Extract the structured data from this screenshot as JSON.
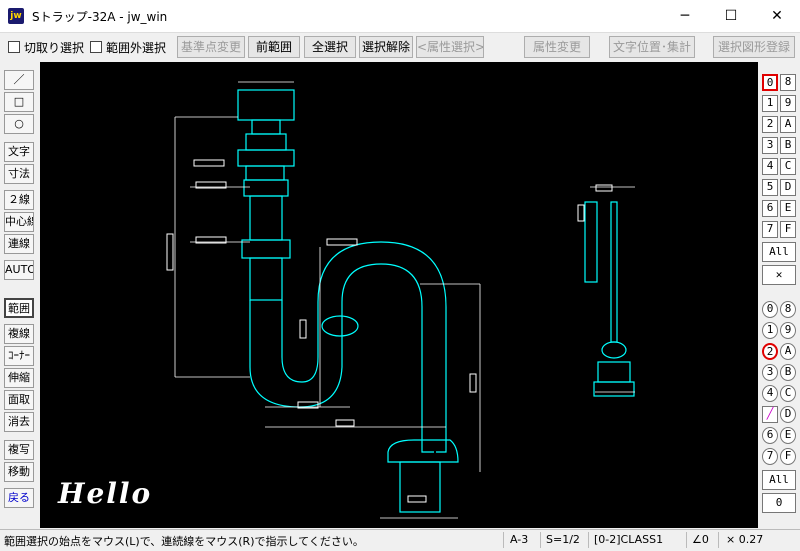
{
  "window": {
    "title": "Sトラップ-32A - jw_win",
    "app_icon": "jw"
  },
  "toolbar": {
    "checkbox_1": "切取り選択",
    "checkbox_2": "範囲外選択",
    "buttons": [
      "基準点変更",
      "前範囲",
      "全選択",
      "選択解除",
      "<属性選択>",
      "属性変更",
      "文字位置･集計",
      "選択図形登録"
    ]
  },
  "left_tools": [
    "／",
    "□",
    "○",
    "文字",
    "寸法",
    "２線",
    "中心線",
    "連線",
    "AUTO",
    "範囲",
    "複線",
    "ｺｰﾅｰ",
    "伸縮",
    "面取",
    "消去",
    "複写",
    "移動",
    "戻る"
  ],
  "canvas": {
    "watermark": "Hello",
    "background": "#000000",
    "line_color": "#00ffff",
    "dim_color": "#ffffff"
  },
  "right_layers": {
    "layer_groups": [
      "0",
      "1",
      "2",
      "3",
      "4",
      "5",
      "6",
      "7",
      "8",
      "9",
      "A",
      "B",
      "C",
      "D",
      "E",
      "F"
    ],
    "all_label": "All",
    "layers": [
      "0",
      "1",
      "2",
      "3",
      "4",
      "5",
      "6",
      "7",
      "8",
      "9",
      "A",
      "B",
      "C",
      "D",
      "E",
      "F"
    ],
    "bottom_label": "0"
  },
  "status": {
    "message": "範囲選択の始点をマウス(L)で、連続線をマウス(R)で指示してください。",
    "paper": "A-3",
    "scale": "S=1/2",
    "layer": "[0-2]CLASS1",
    "angle": "∠0",
    "zoom": "× 0.27"
  },
  "icons": {
    "minimize": "minimize-icon",
    "maximize": "maximize-icon",
    "close": "close-icon",
    "cross": "cross-icon",
    "pen": "pen-icon"
  }
}
